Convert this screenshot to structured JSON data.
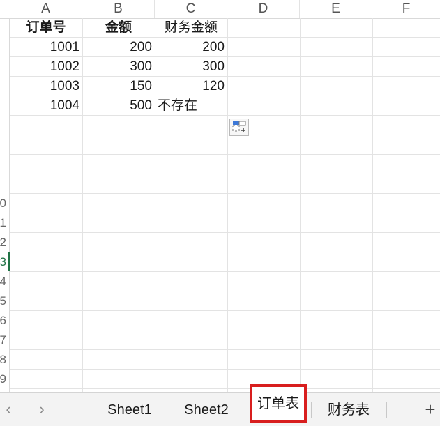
{
  "columns": [
    "A",
    "B",
    "C",
    "D",
    "E",
    "F"
  ],
  "row_numbers": [
    "0",
    "1",
    "2",
    "3",
    "4",
    "5",
    "6",
    "7",
    "8",
    "9"
  ],
  "active_row": "3",
  "cells": {
    "a1": "订单号",
    "b1": "金额",
    "c1": "财务金额",
    "a2": "1001",
    "b2": "200",
    "c2": "200",
    "a3": "1002",
    "b3": "300",
    "c3": "300",
    "a4": "1003",
    "b4": "150",
    "c4": "120",
    "a5": "1004",
    "b5": "500",
    "c5": "不存在"
  },
  "tabs": [
    "Sheet1",
    "Sheet2",
    "订单表",
    "财务表"
  ],
  "active_tab": "订单表",
  "nav": {
    "prev": "‹",
    "next": "›",
    "add": "+"
  },
  "colors": {
    "accent": "#217346",
    "highlight_border": "#d81e1e",
    "paste_icon_blue": "#3c78d8"
  }
}
